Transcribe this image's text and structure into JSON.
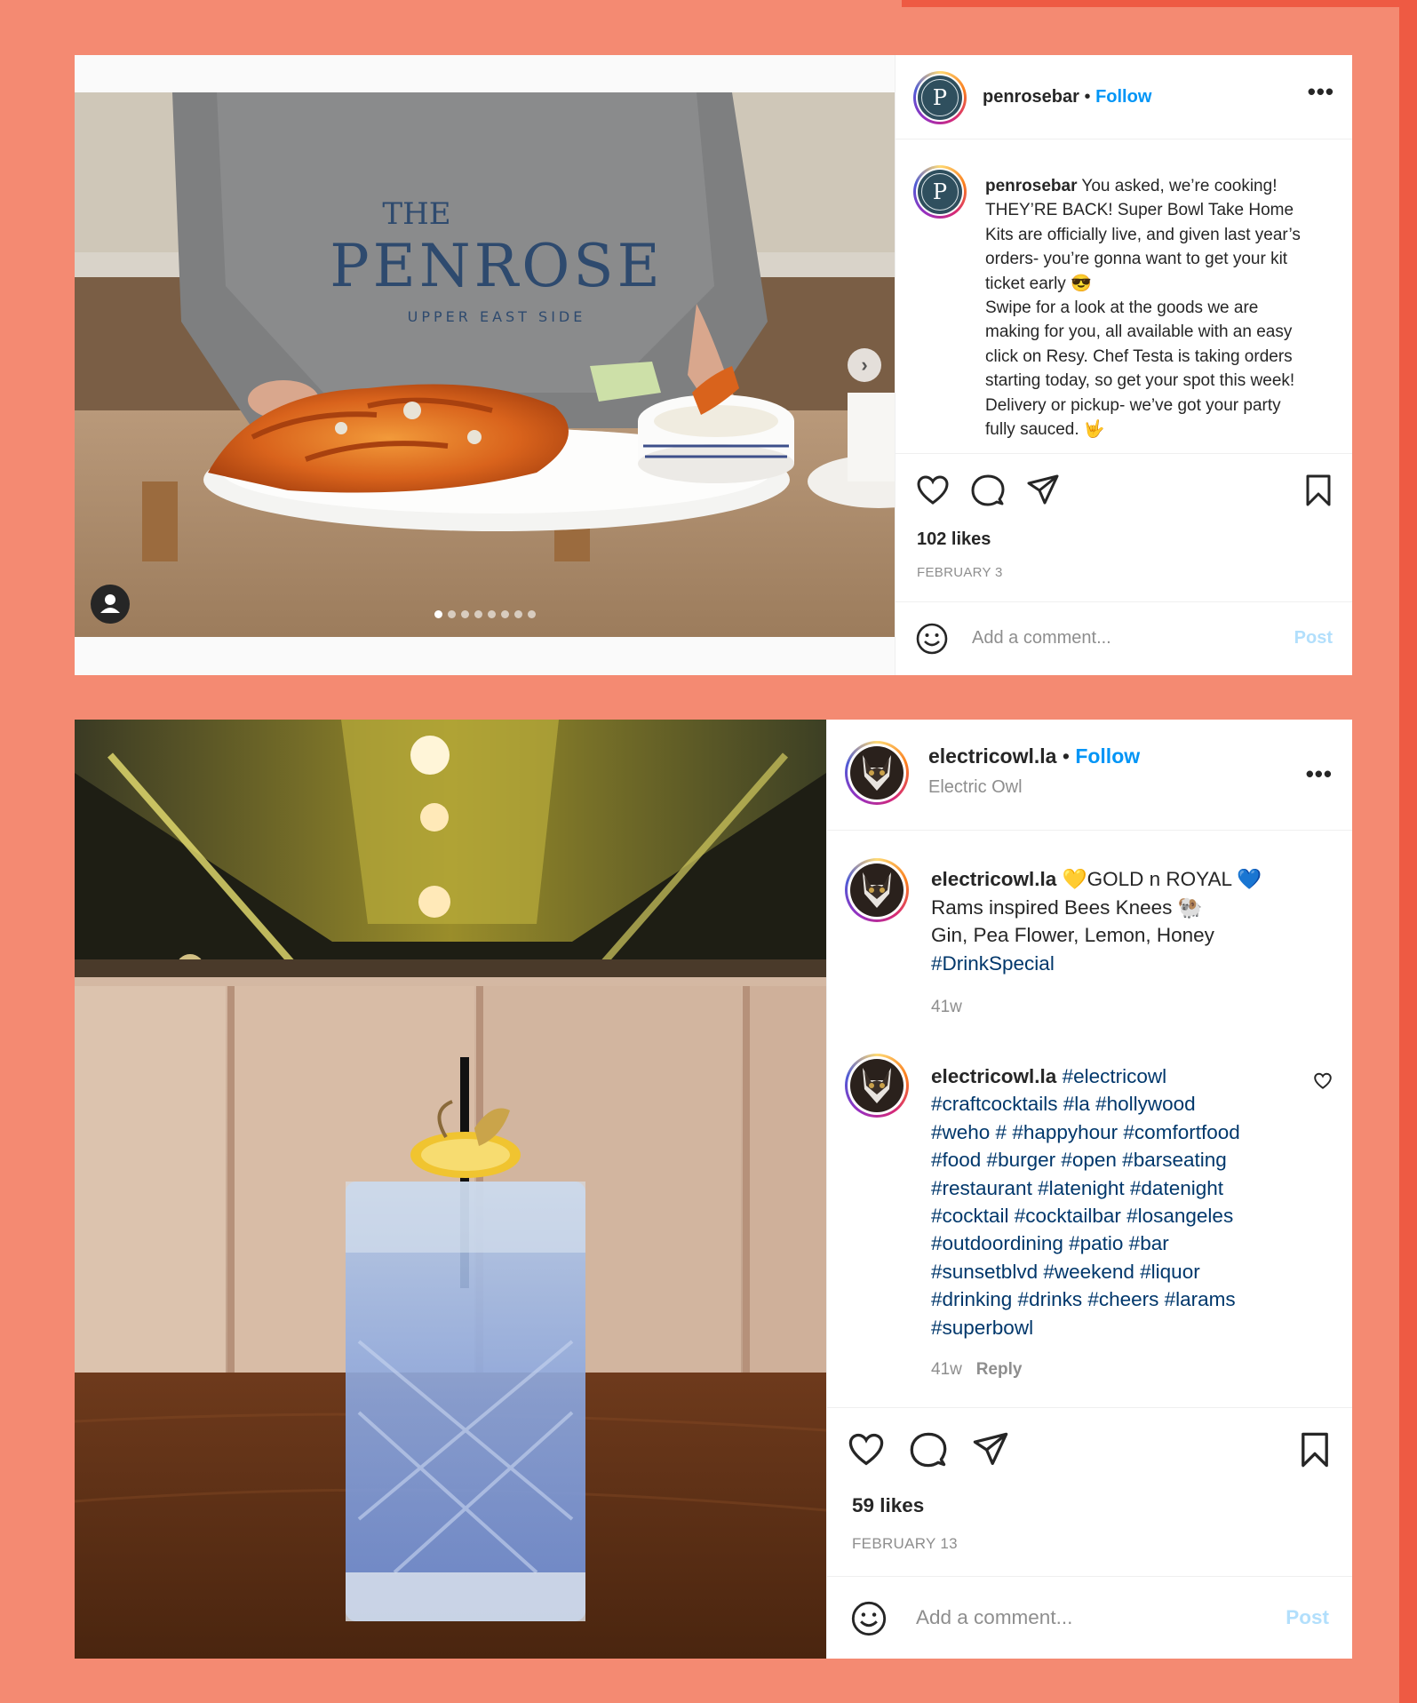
{
  "colors": {
    "background": "#f48a72",
    "accent": "#ee5a43",
    "link": "#0095f6",
    "hashtag": "#00376b"
  },
  "post1": {
    "username": "penrosebar",
    "follow_label": "Follow",
    "more_label": "•••",
    "caption_lines": [
      "You asked, we’re cooking!",
      "THEY’RE BACK! Super Bowl Take Home",
      "Kits are officially live, and given last year’s",
      "orders- you’re gonna want to get your kit",
      "ticket early 😎",
      "Swipe for a look at the goods we are",
      "making for you, all available with an easy",
      "click on Resy. Chef Testa is taking orders",
      "starting today, so get your spot this week!",
      "Delivery or pickup- we’ve got your party",
      "fully sauced. 🤟"
    ],
    "likes": "102 likes",
    "date": "FEBRUARY 3",
    "comment_placeholder": "Add a comment...",
    "post_label": "Post",
    "sweatshirt_line1": "THE",
    "sweatshirt_line2": "PENROSE",
    "sweatshirt_line3": "UPPER EAST SIDE",
    "carousel_count": 8
  },
  "post2": {
    "username": "electricowl.la",
    "follow_label": "Follow",
    "location": "Electric Owl",
    "more_label": "•••",
    "caption": {
      "lead": "💛GOLD n ROYAL 💙",
      "line2": "Rams inspired Bees Knees 🐏",
      "line3": "Gin, Pea Flower, Lemon, Honey",
      "hashtag": "#DrinkSpecial",
      "time": "41w"
    },
    "comment": {
      "lines": [
        "#electricowl",
        "#craftcocktails #la #hollywood",
        "#weho # #happyhour #comfortfood",
        "#food #burger #open #barseating",
        "#restaurant #latenight #datenight",
        "#cocktail #cocktailbar #losangeles",
        "#outdoordining #patio #bar",
        "#sunsetblvd #weekend #liquor",
        "#drinking #drinks #cheers #larams",
        "#superbowl"
      ],
      "time": "41w",
      "reply_label": "Reply"
    },
    "likes": "59 likes",
    "date": "FEBRUARY 13",
    "comment_placeholder": "Add a comment...",
    "post_label": "Post"
  },
  "icons": {
    "like": "heart-icon",
    "comment": "speech-bubble-icon",
    "share": "paper-plane-icon",
    "save": "bookmark-icon",
    "emoji": "smiley-icon",
    "next": "chevron-right-icon",
    "tag": "person-icon"
  }
}
